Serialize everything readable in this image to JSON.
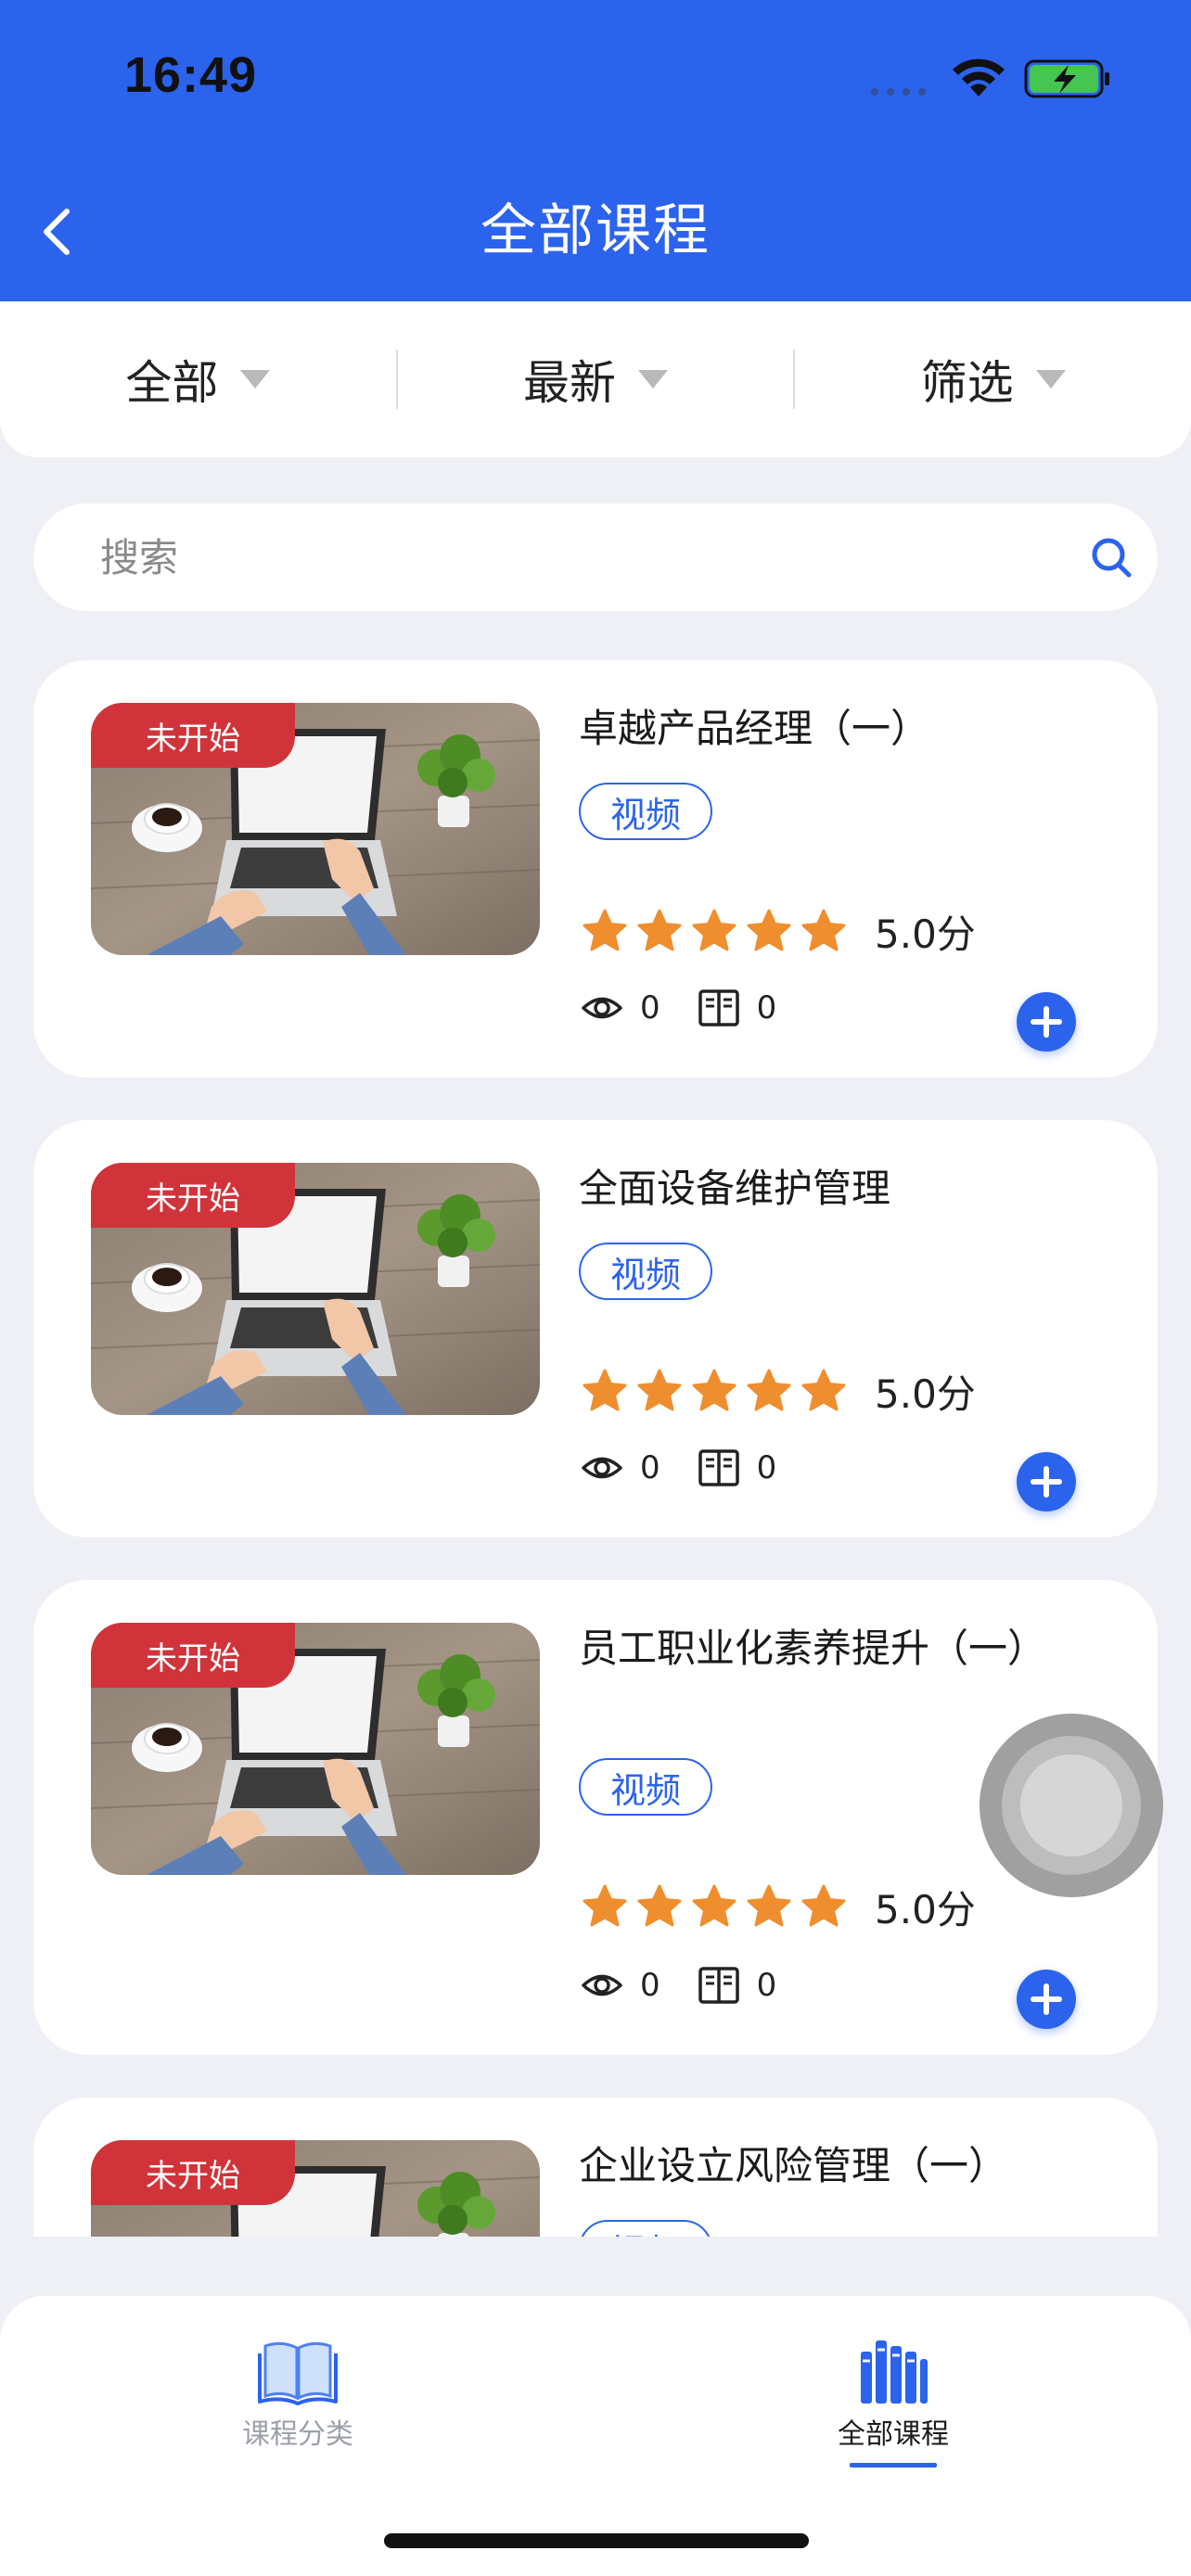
{
  "status_bar": {
    "time": "16:49"
  },
  "header": {
    "title": "全部课程"
  },
  "filters": [
    {
      "label": "全部"
    },
    {
      "label": "最新"
    },
    {
      "label": "筛选"
    }
  ],
  "search": {
    "placeholder": "搜索",
    "value": ""
  },
  "courses": [
    {
      "status": "未开始",
      "title": "卓越产品经理（一）",
      "type": "视频",
      "rating": 5,
      "rating_text": "5.0分",
      "views": "0",
      "lessons": "0"
    },
    {
      "status": "未开始",
      "title": "全面设备维护管理",
      "type": "视频",
      "rating": 5,
      "rating_text": "5.0分",
      "views": "0",
      "lessons": "0"
    },
    {
      "status": "未开始",
      "title": "员工职业化素养提升（一）",
      "type": "视频",
      "rating": 5,
      "rating_text": "5.0分",
      "views": "0",
      "lessons": "0"
    },
    {
      "status": "未开始",
      "title": "企业设立风险管理（一）",
      "type": "视频"
    }
  ],
  "bottom_nav": [
    {
      "label": "课程分类",
      "icon": "book-open-icon",
      "active": false
    },
    {
      "label": "全部课程",
      "icon": "library-books-icon",
      "active": true
    }
  ],
  "colors": {
    "primary": "#2b63ed",
    "tag_red": "#d0343a",
    "star": "#ef8e2f"
  }
}
